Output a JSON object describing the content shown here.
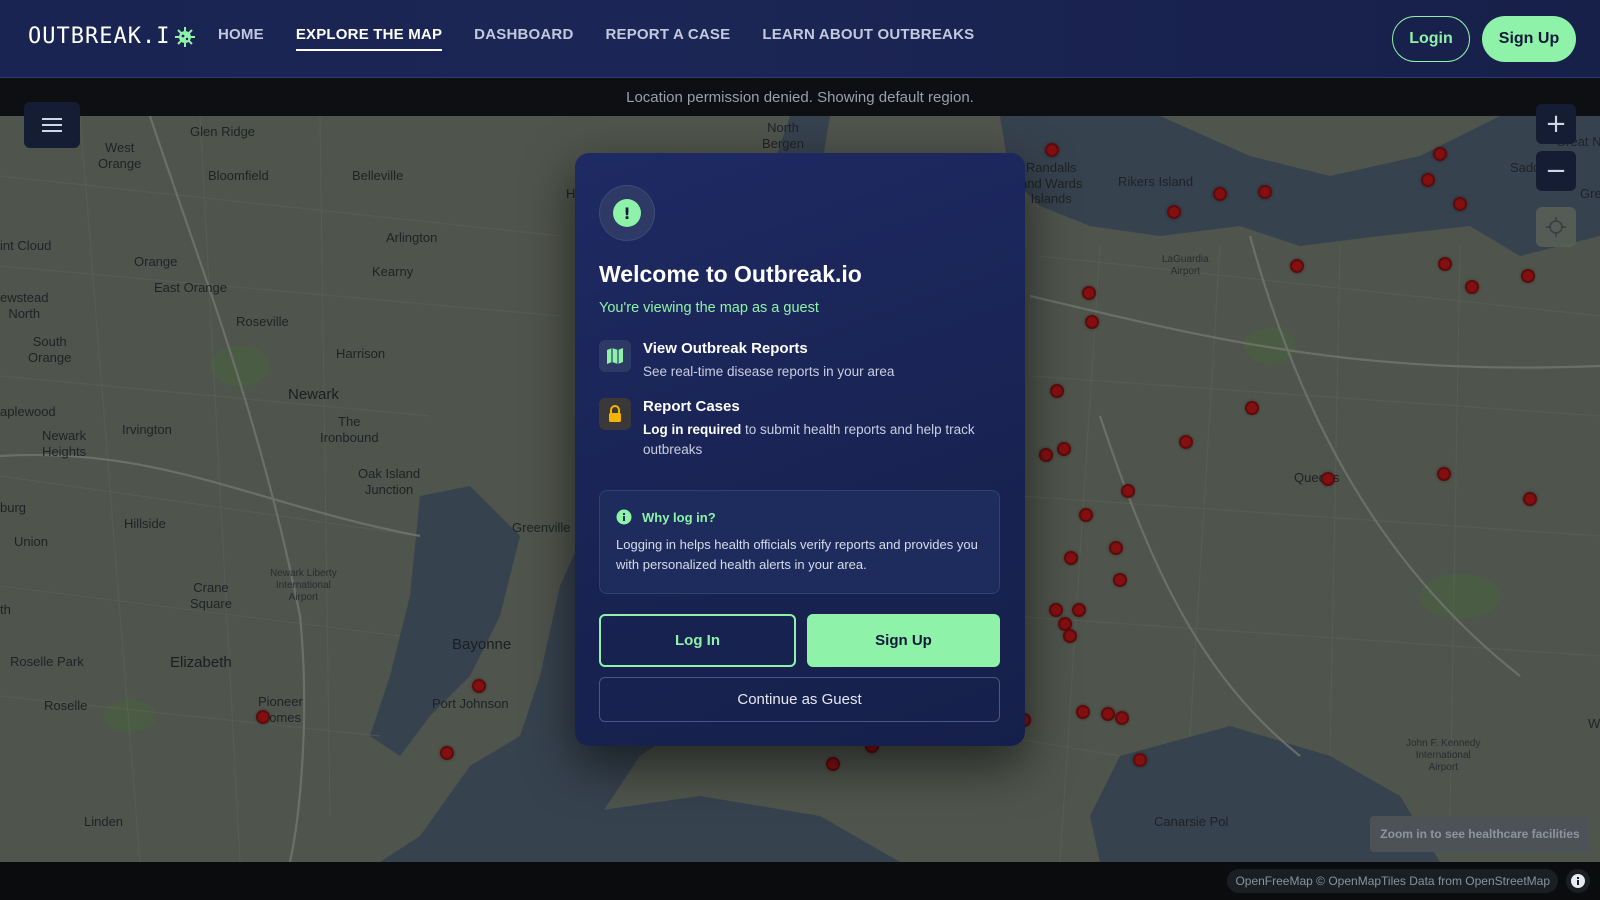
{
  "nav": {
    "logo_text": "OUTBREAK.I",
    "links": [
      "HOME",
      "EXPLORE THE MAP",
      "DASHBOARD",
      "REPORT A CASE",
      "LEARN ABOUT OUTBREAKS"
    ],
    "login_label": "Login",
    "signup_label": "Sign Up"
  },
  "status": {
    "message": "Location permission denied. Showing default region."
  },
  "map": {
    "labels": {
      "glen_ridge": "Glen Ridge",
      "west_orange": "West\nOrange",
      "bloomfield": "Bloomfield",
      "belleville": "Belleville",
      "north_bergen": "North\nBergen",
      "arlington": "Arlington",
      "kearny": "Kearny",
      "orange": "Orange",
      "east_orange": "East Orange",
      "roseville": "Roseville",
      "harrison": "Harrison",
      "newark": "Newark",
      "the_ironbound": "The\nIronbound",
      "irvington": "Irvington",
      "newark_heights": "Newark\nHeights",
      "oak_island": "Oak Island\nJunction",
      "hillside": "Hillside",
      "union": "Union",
      "greenville": "Greenville",
      "crane_square": "Crane\nSquare",
      "newark_airport": "Newark Liberty\nInternational\nAirport",
      "bayonne": "Bayonne",
      "elizabeth": "Elizabeth",
      "roselle_park": "Roselle Park",
      "roselle": "Roselle",
      "pioneer_homes": "Pioneer\nHomes",
      "port_johnson": "Port Johnson",
      "linden": "Linden",
      "randalls": "Randalls\nand Wards\nIslands",
      "rikers": "Rikers Island",
      "laguardia": "LaGuardia\nAirport",
      "queens": "Queens",
      "jfk": "John F. Kennedy\nInternational\nAirport",
      "canarsie": "Canarsie Pol",
      "glen_cloud": "int Cloud",
      "newstead": "ewstead\nNorth",
      "south_orange": "South\nOrange",
      "maplewood": "aplewood",
      "burg": "burg",
      "th": "th",
      "great_neck": "Great N",
      "sadd": "Sadd",
      "gre": "Gre",
      "w": "W",
      "h": "H"
    },
    "case_count": 46,
    "zoom_in_label": "+",
    "zoom_out_label": "−",
    "zoom_hint": "Zoom in to see healthcare facilities",
    "attribution": "OpenFreeMap © OpenMapTiles Data from OpenStreetMap",
    "case_color": "#9b0c0c"
  },
  "modal": {
    "title": "Welcome to Outbreak.io",
    "subtitle": "You're viewing the map as a guest",
    "feature1_title": "View Outbreak Reports",
    "feature1_desc": "See real-time disease reports in your area",
    "feature2_title": "Report Cases",
    "feature2_bold": "Log in required",
    "feature2_desc": " to submit health reports and help track outbreaks",
    "why_title": "Why log in?",
    "why_text": "Logging in helps health officials verify reports and provides you with personalized health alerts in your area.",
    "login_label": "Log In",
    "signup_label": "Sign Up",
    "guest_label": "Continue as Guest"
  },
  "colors": {
    "accent": "#8ef2a8",
    "nav_bg": "#1a2452",
    "modal_bg": "#1a2456"
  }
}
